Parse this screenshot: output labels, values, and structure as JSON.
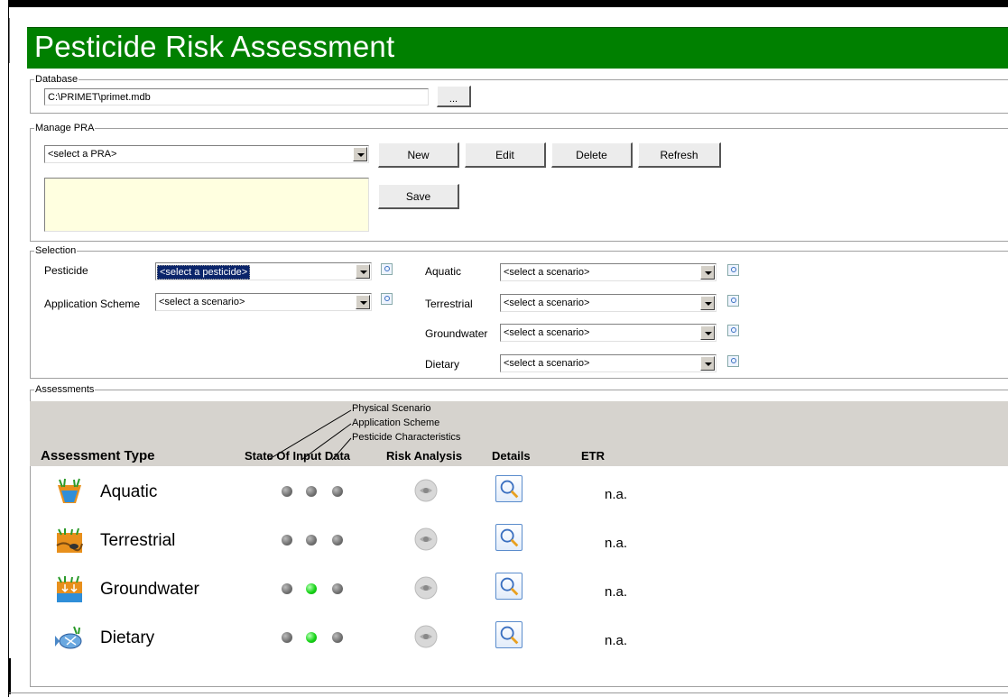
{
  "app": {
    "title": "Pesticide Risk Assessment"
  },
  "database": {
    "group_label": "Database",
    "path": "C:\\PRIMET\\primet.mdb",
    "browse_label": "..."
  },
  "manage": {
    "group_label": "Manage PRA",
    "pra_select": "<select a PRA>",
    "new_label": "New",
    "edit_label": "Edit",
    "delete_label": "Delete",
    "refresh_label": "Refresh",
    "save_label": "Save",
    "notes_value": ""
  },
  "selection": {
    "group_label": "Selection",
    "pesticide_label": "Pesticide",
    "pesticide_value": "<select a pesticide>",
    "app_scheme_label": "Application Scheme",
    "app_scheme_value": "<select a scenario>",
    "aquatic_label": "Aquatic",
    "aquatic_value": "<select a scenario>",
    "terrestrial_label": "Terrestrial",
    "terrestrial_value": "<select a scenario>",
    "groundwater_label": "Groundwater",
    "groundwater_value": "<select a scenario>",
    "dietary_label": "Dietary",
    "dietary_value": "<select a scenario>"
  },
  "assessments": {
    "group_label": "Assessments",
    "headers": {
      "type": "Assessment Type",
      "state": "State Of Input Data",
      "risk": "Risk Analysis",
      "details": "Details",
      "etr": "ETR"
    },
    "annotations": [
      "Physical Scenario",
      "Application Scheme",
      "Pesticide Characteristics"
    ],
    "rows": [
      {
        "name": "Aquatic",
        "icon": "aquatic-icon",
        "states": [
          "gray",
          "gray",
          "gray"
        ],
        "etr": "n.a."
      },
      {
        "name": "Terrestrial",
        "icon": "terrestrial-icon",
        "states": [
          "gray",
          "gray",
          "gray"
        ],
        "etr": "n.a."
      },
      {
        "name": "Groundwater",
        "icon": "groundwater-icon",
        "states": [
          "gray",
          "green",
          "gray"
        ],
        "etr": "n.a."
      },
      {
        "name": "Dietary",
        "icon": "dietary-icon",
        "states": [
          "gray",
          "green",
          "gray"
        ],
        "etr": "n.a."
      }
    ]
  },
  "colors": {
    "title_bg": "#008000",
    "state_ok": "#18d418",
    "state_missing": "#808080",
    "selected_item": "#0a246a",
    "notes_bg": "#ffffe0"
  }
}
